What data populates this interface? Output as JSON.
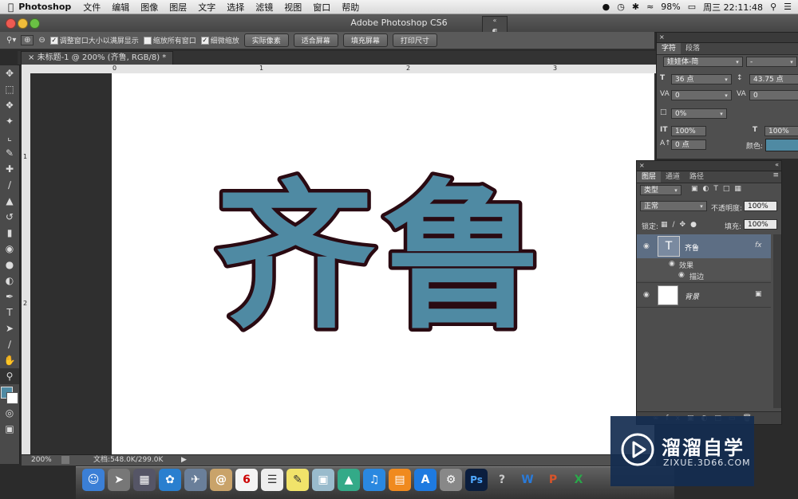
{
  "menubar": {
    "app_name": "Photoshop",
    "items": [
      "文件",
      "编辑",
      "图像",
      "图层",
      "文字",
      "选择",
      "滤镜",
      "视图",
      "窗口",
      "帮助"
    ],
    "battery": "98%",
    "clock": "周三 22:11:48"
  },
  "window": {
    "title": "Adobe Photoshop CS6"
  },
  "options_bar": {
    "cb_resize_label": "调整窗口大小以满屏显示",
    "cb_zoom_all_label": "缩放所有窗口",
    "cb_scrubby_label": "细微缩放",
    "btn_actual_pixels": "实际像素",
    "btn_fit_screen": "适合屏幕",
    "btn_fill_screen": "填充屏幕",
    "btn_print_size": "打印尺寸"
  },
  "document": {
    "tab_title": "未标题-1 @ 200% (齐鲁, RGB/8) *",
    "ruler_h": [
      "0",
      "1",
      "2",
      "3"
    ],
    "ruler_v": [
      "1",
      "2"
    ],
    "canvas_text": "齐鲁",
    "text_fill": "#4f8aa3",
    "text_stroke": "#2a0a12"
  },
  "status_bar": {
    "zoom": "200%",
    "doc_info": "文档:548.0K/299.0K"
  },
  "character_panel": {
    "tabs": [
      "字符",
      "段落"
    ],
    "font_family": "娃娃体-简",
    "font_style": "-",
    "font_size": "36 点",
    "leading": "43.75 点",
    "kerning": "0",
    "tracking": "0",
    "tsume": "0%",
    "vertical_scale": "100%",
    "horizontal_scale": "100%",
    "baseline_shift": "0 点",
    "color_label": "颜色:",
    "color_swatch": "#4f8aa3"
  },
  "layers_panel": {
    "tabs": [
      "图层",
      "通道",
      "路径"
    ],
    "filter_kind": "类型",
    "blend_mode": "正常",
    "opacity_label": "不透明度:",
    "opacity": "100%",
    "lock_label": "锁定:",
    "fill_label": "填充:",
    "fill": "100%",
    "layers": [
      {
        "name": "齐鲁",
        "type": "text",
        "fx": "fx",
        "effects_label": "效果",
        "effect": "描边"
      },
      {
        "name": "背景",
        "type": "background"
      }
    ]
  },
  "watermark": {
    "brand": "溜溜自学",
    "url": "ZIXUE.3D66.COM"
  }
}
